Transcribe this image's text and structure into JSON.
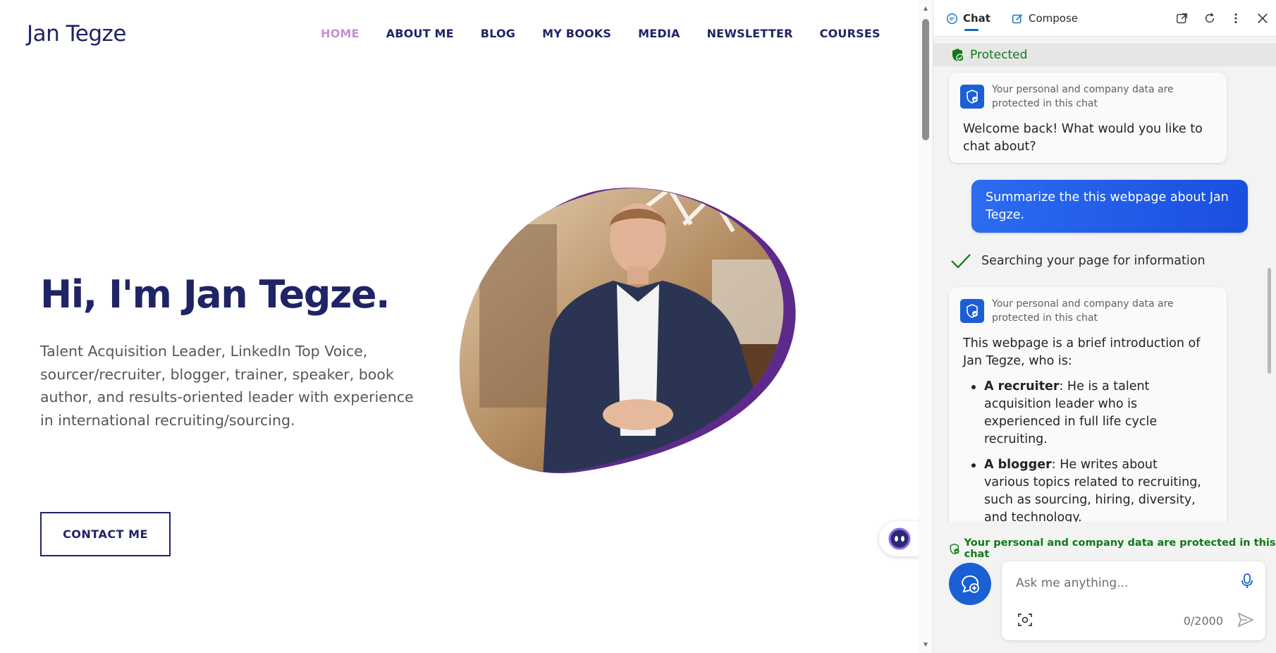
{
  "site": {
    "brand": "Jan Tegze",
    "nav": [
      {
        "label": "HOME",
        "active": true
      },
      {
        "label": "ABOUT ME",
        "active": false
      },
      {
        "label": "BLOG",
        "active": false
      },
      {
        "label": "MY BOOKS",
        "active": false
      },
      {
        "label": "MEDIA",
        "active": false
      },
      {
        "label": "NEWSLETTER",
        "active": false
      },
      {
        "label": "COURSES",
        "active": false
      }
    ],
    "hero_title": "Hi, I'm Jan Tegze.",
    "hero_description": "Talent Acquisition Leader, LinkedIn Top Voice, sourcer/recruiter, blogger, trainer, speaker, book author, and results-oriented leader with experience in international recruiting/sourcing.",
    "contact_button": "CONTACT ME"
  },
  "copilot": {
    "tabs": {
      "chat": "Chat",
      "compose": "Compose"
    },
    "protected_label": "Protected",
    "card1": {
      "note": "Your personal and company data are protected in this chat",
      "message": "Welcome back! What would you like to chat about?"
    },
    "user_message": "Summarize the this webpage about Jan Tegze.",
    "search_status": "Searching your page for information",
    "card2": {
      "note": "Your personal and company data are protected in this chat",
      "intro": "This webpage is a brief introduction of Jan Tegze, who is:",
      "bullets": [
        {
          "title": "A recruiter",
          "text": ": He is a talent acquisition leader who is experienced in full life cycle recruiting."
        },
        {
          "title": "A blogger",
          "text": ": He writes about various topics related to recruiting, such as sourcing, hiring, diversity, and technology."
        }
      ]
    },
    "bottom_note": "Your personal and company data are protected in this chat",
    "input_placeholder": "Ask me anything...",
    "char_counter": "0/2000"
  },
  "colors": {
    "brand_navy": "#1f2466",
    "nav_active": "#c58fd6",
    "copilot_blue": "#1a5fd4",
    "protected_green": "#0e7a16"
  }
}
